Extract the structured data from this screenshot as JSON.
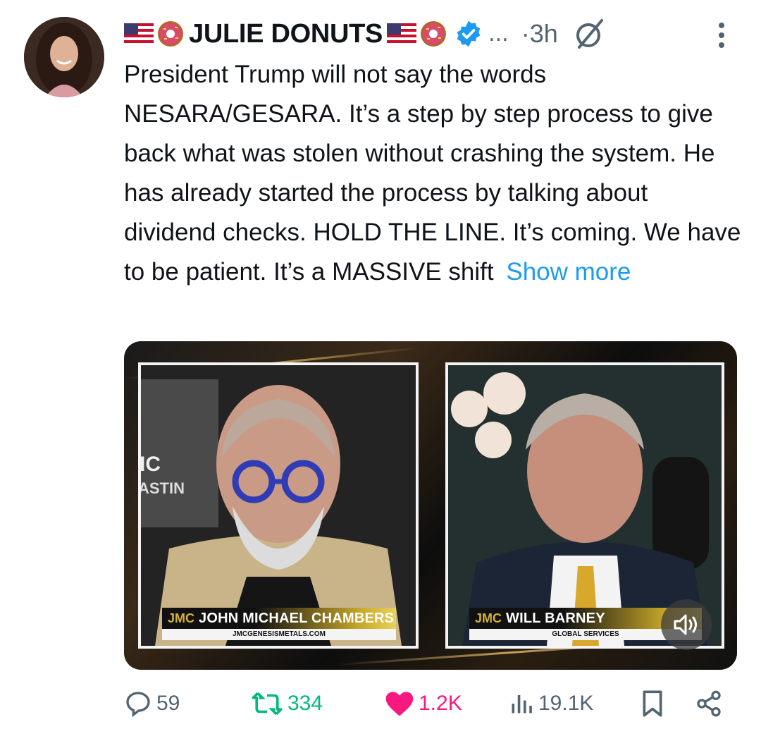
{
  "tweet": {
    "display_name": "JULIE DONUTS",
    "ellipsis": "...",
    "time": "·3h",
    "text": "President Trump will not say the words NESARA/GESARA. It’s a step by step process to give back what was stolen without crashing the system. He has already started the process by talking about dividend checks. HOLD THE LINE. It’s coming. We have to be patient. It’s a MASSIVE shift",
    "show_more": "Show more"
  },
  "media": {
    "left_panel": {
      "logo": "JMC",
      "name": "JOHN MICHAEL CHAMBERS",
      "sub": "JMCGENESISMETALS.COM",
      "bg_text": "IC\nASTIN"
    },
    "right_panel": {
      "logo": "JMC",
      "name": "WILL BARNEY",
      "sub": "GLOBAL SERVICES"
    }
  },
  "actions": {
    "replies": "59",
    "reposts": "334",
    "likes": "1.2K",
    "views": "19.1K"
  },
  "colors": {
    "accent": "#1d9bf0",
    "repost": "#00ba7c",
    "like": "#f91880",
    "muted": "#536471",
    "text": "#0f1419"
  },
  "icons": [
    "flag-usa-icon",
    "donut-icon",
    "verified-icon",
    "grok-icon",
    "more-icon",
    "reply-icon",
    "repost-icon",
    "like-icon",
    "views-icon",
    "bookmark-icon",
    "share-icon",
    "volume-icon"
  ]
}
